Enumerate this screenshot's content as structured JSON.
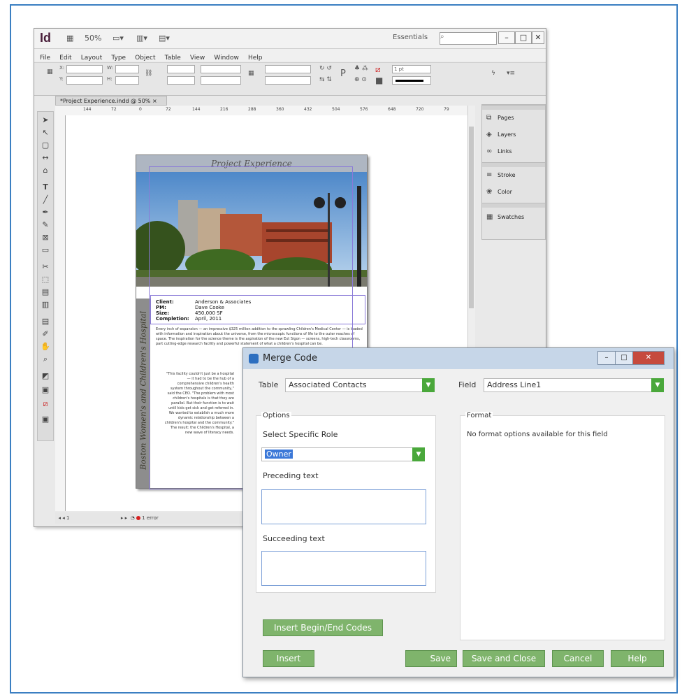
{
  "indesign": {
    "app_icon": "Id",
    "zoom": "50%",
    "workspace": "Essentials",
    "menu": [
      "File",
      "Edit",
      "Layout",
      "Type",
      "Object",
      "Table",
      "View",
      "Window",
      "Help"
    ],
    "doc_tab": "*Project Experience.indd @ 50%",
    "ruler_ticks": [
      "144",
      "72",
      "0",
      "72",
      "144",
      "216",
      "288",
      "360",
      "432",
      "504",
      "576",
      "648",
      "720",
      "79"
    ],
    "status": {
      "page": "1",
      "errors": "1 error"
    },
    "panels": [
      "Pages",
      "Layers",
      "Links",
      "Stroke",
      "Color",
      "Swatches"
    ],
    "stroke_weight": "1 pt"
  },
  "document": {
    "heading": "Project Experience",
    "side_title": "Boston Women's and Children's Hospital",
    "info": [
      {
        "label": "Client:",
        "value": "Anderson & Associates"
      },
      {
        "label": "PM:",
        "value": "Dave Cooke"
      },
      {
        "label": "Size:",
        "value": "450,000 SF"
      },
      {
        "label": "Completion:",
        "value": "April, 2011"
      }
    ],
    "body": "Every inch of expansion — an impressive $325 million addition to the sprawling Children's Medical Center — is loaded with information and inspiration about the universe, from the microscopic functions of life to the outer reaches of space. The inspiration for the science theme is the aspiration of the new Ext Sigon — screens, high-tech classrooms, part cutting-edge research facility and powerful statement of what a children's hospital can be.",
    "quote": "\"This facility couldn't just be a hospital — it had to be the hub of a comprehensive children's health system throughout the community,\" said the CEO. \"The problem with most children's hospitals is that they are parallel. But their function is to wait until kids get sick and get referred in. We wanted to establish a much more dynamic relationship between a children's hospital and the community.\" The result: the Children's Hospital, a new wave of literacy needs."
  },
  "dialog": {
    "title": "Merge Code",
    "table_label": "Table",
    "table_value": "Associated Contacts",
    "field_label": "Field",
    "field_value": "Address Line1",
    "options_title": "Options",
    "select_role_label": "Select Specific Role",
    "role_value": "Owner",
    "preceding_label": "Preceding text",
    "succeeding_label": "Succeeding text",
    "format_title": "Format",
    "format_message": "No format options available for this field",
    "btn_begin_end": "Insert Begin/End Codes",
    "btn_insert": "Insert",
    "btn_save": "Save",
    "btn_save_close": "Save and Close",
    "btn_cancel": "Cancel",
    "btn_help": "Help"
  },
  "colors": {
    "frame": "#3b7fc2",
    "dialog_button": "#7fb46c",
    "dropdown_arrow": "#4aa83b",
    "selection": "#3b78d8"
  }
}
